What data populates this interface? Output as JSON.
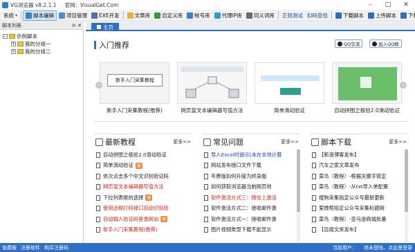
{
  "window": {
    "title": "VG浏览器  v8.2.1.1",
    "site": "官网：VisualGet.Com"
  },
  "toolbar": [
    {
      "label": "系统",
      "dd": true
    },
    {
      "label": "脚本编辑",
      "active": true,
      "color": "#3a7fd0"
    },
    {
      "label": "项目管理",
      "color": "#4a8fd8"
    },
    {
      "label": "EXE开发",
      "color": "#5a6ea8"
    },
    {
      "label": "文章库",
      "color": "#e7b23c"
    },
    {
      "label": "自定义库",
      "color": "#3a9a3a"
    },
    {
      "label": "帐号库",
      "color": "#3a7fd0"
    },
    {
      "label": "代理IP库",
      "color": "#2a9ad8"
    },
    {
      "label": "同义词库",
      "color": "#6a6a6a"
    },
    {
      "label": "正则测试",
      "color": "",
      "blue": true
    },
    {
      "label": "扣码查找",
      "color": "",
      "blue": true
    },
    {
      "label": "下载脚本",
      "color": "#2e6fc6"
    },
    {
      "label": "上传脚本",
      "color": "#2e6fc6"
    },
    {
      "label": "下载管理",
      "color": "#2e6fc6"
    }
  ],
  "left": {
    "title": "脚本列表",
    "pin": "ᐅ",
    "close": "✕",
    "root": "示例脚本",
    "children": [
      "我的分组一",
      "我的分组二"
    ]
  },
  "tab": {
    "label": "主页"
  },
  "recommend": {
    "title": "入门推荐",
    "qq": "QQ交流",
    "qq_group": "加入QQ群",
    "cards": [
      {
        "caption": "新手入门采集教程(推荐)",
        "thumb": "新手入门采集教程"
      },
      {
        "caption": "网页富文本编辑器写值方法",
        "thumb": ""
      },
      {
        "caption": "简单滑动验证",
        "thumb": ""
      },
      {
        "caption": "自动拼图之极验2.0滑动验证",
        "thumb": ""
      }
    ]
  },
  "panels": [
    {
      "title": "最新教程",
      "more": "更多>>",
      "items": [
        {
          "text": "自动拼图之极验2.0滑动验证",
          "style": ""
        },
        {
          "text": "简单滑动验证",
          "style": "",
          "hot": "荐"
        },
        {
          "text": "依次点击多个中文识别验证码",
          "style": ""
        },
        {
          "text": "网页富文本编辑器写值方法",
          "style": "red"
        },
        {
          "text": "下拉列表框的选择",
          "style": "",
          "hot": "荐"
        },
        {
          "text": "使用远程打码接口自动识别验",
          "style": "red"
        },
        {
          "text": "自动输入验证码登录网站",
          "style": "red",
          "hot": "荐"
        },
        {
          "text": "新手入门采集教程(推荐)",
          "style": "red"
        }
      ]
    },
    {
      "title": "常见问题",
      "more": "更多>>",
      "items": [
        {
          "text": "导入Excel时提示[未在本地计算",
          "style": "blue"
        },
        {
          "text": "网站发布接口文件下载",
          "style": ""
        },
        {
          "text": "年费版如何升级为终身版",
          "style": ""
        },
        {
          "text": "如何获取浏览器当前网页地",
          "style": ""
        },
        {
          "text": "软件激活方式三：微信上激活",
          "style": "red"
        },
        {
          "text": "软件激活方式二：接收邮件激",
          "style": ""
        },
        {
          "text": "软件激活方式一：接收邮件激",
          "style": ""
        },
        {
          "text": "图片视频类型下载不能显示",
          "style": ""
        }
      ]
    },
    {
      "title": "脚本下载",
      "more": "更多>>",
      "items": [
        {
          "text": "【新浪博客发布】",
          "style": ""
        },
        {
          "text": "汽车之家文章发布",
          "style": ""
        },
        {
          "text": "菜鸟（教程）-根据关键字锁定",
          "style": ""
        },
        {
          "text": "菜鸟（教程）-从txt导入单配置",
          "style": ""
        },
        {
          "text": "搜狗采集指定公众号最新更新",
          "style": ""
        },
        {
          "text": "爱微帮指定公众号采集标题网",
          "style": ""
        },
        {
          "text": "菜鸟（教程）-亚马逊商城批量",
          "style": ""
        },
        {
          "text": "【百度文库发布】",
          "style": ""
        }
      ]
    }
  ],
  "status": {
    "left": [
      "免费版",
      "注册软件",
      "购买注册码"
    ],
    "pos_label": "当前用户：",
    "pos_val": "尚未登陆，点这里登录"
  }
}
